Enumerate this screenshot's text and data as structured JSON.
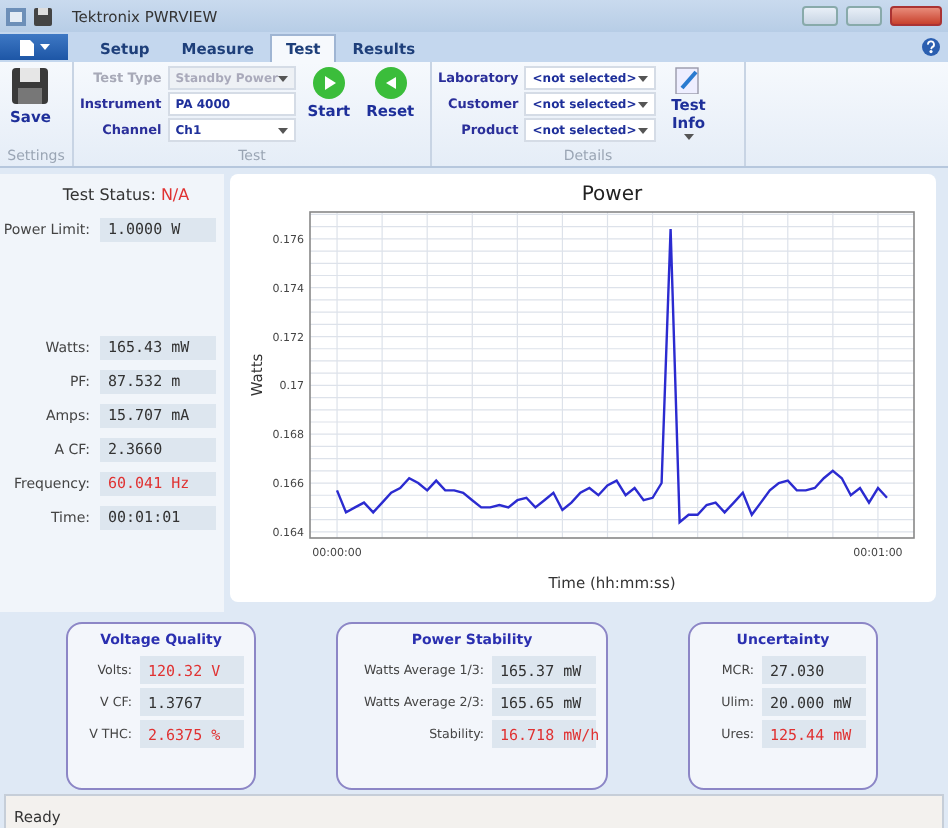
{
  "window": {
    "title": "Tektronix PWRVIEW"
  },
  "tabs": [
    {
      "label": "Setup",
      "selected": false
    },
    {
      "label": "Measure",
      "selected": false
    },
    {
      "label": "Test",
      "selected": true
    },
    {
      "label": "Results",
      "selected": false
    }
  ],
  "settings_group": {
    "label": "Settings",
    "save_button": "Save"
  },
  "test_group": {
    "label": "Test",
    "fields": [
      {
        "label": "Test Type",
        "value": "Standby Power",
        "kind": "dropdown",
        "disabled": true
      },
      {
        "label": "Instrument",
        "value": "PA 4000",
        "kind": "text",
        "disabled": false
      },
      {
        "label": "Channel",
        "value": "Ch1",
        "kind": "dropdown",
        "disabled": false
      }
    ],
    "buttons": [
      {
        "label": "Start",
        "kind": "start"
      },
      {
        "label": "Reset",
        "kind": "reset"
      }
    ]
  },
  "details_group": {
    "label": "Details",
    "fields": [
      {
        "label": "Laboratory",
        "value": "<not selected>"
      },
      {
        "label": "Customer",
        "value": "<not selected>"
      },
      {
        "label": "Product",
        "value": "<not selected>"
      }
    ],
    "test_info_button": "Test Info"
  },
  "test_status": {
    "label": "Test Status:",
    "value": "N/A",
    "alert": true
  },
  "power_limit": {
    "label": "Power Limit:",
    "value": "1.0000 W",
    "alert": false
  },
  "measurements": [
    {
      "label": "Watts:",
      "value": "165.43 mW",
      "alert": false
    },
    {
      "label": "PF:",
      "value": "87.532 m",
      "alert": false
    },
    {
      "label": "Amps:",
      "value": "15.707 mA",
      "alert": false
    },
    {
      "label": "A CF:",
      "value": "2.3660",
      "alert": false
    },
    {
      "label": "Frequency:",
      "value": "60.041 Hz",
      "alert": true
    },
    {
      "label": "Time:",
      "value": "00:01:01",
      "alert": false
    }
  ],
  "chart": {
    "chart_data": {
      "type": "line",
      "title": "Power",
      "xlabel": "Time (hh:mm:ss)",
      "ylabel": "Watts",
      "x": [
        0,
        1,
        2,
        3,
        4,
        5,
        6,
        7,
        8,
        9,
        10,
        11,
        12,
        13,
        14,
        15,
        16,
        17,
        18,
        19,
        20,
        21,
        22,
        23,
        24,
        25,
        26,
        27,
        28,
        29,
        30,
        31,
        32,
        33,
        34,
        35,
        36,
        37,
        38,
        39,
        40,
        41,
        42,
        43,
        44,
        45,
        46,
        47,
        48,
        49,
        50,
        51,
        52,
        53,
        54,
        55,
        56,
        57,
        58,
        59,
        60,
        61
      ],
      "grid": true,
      "series": [
        {
          "color": "#2b2bd0",
          "values": [
            0.1657,
            0.1648,
            0.165,
            0.1652,
            0.1648,
            0.1652,
            0.1656,
            0.1658,
            0.1662,
            0.166,
            0.1657,
            0.1661,
            0.1657,
            0.1657,
            0.1656,
            0.1653,
            0.165,
            0.165,
            0.1651,
            0.165,
            0.1653,
            0.1654,
            0.165,
            0.1653,
            0.1656,
            0.1649,
            0.1652,
            0.1656,
            0.1658,
            0.1655,
            0.1659,
            0.1661,
            0.1655,
            0.1658,
            0.1653,
            0.1654,
            0.166,
            0.1764,
            0.1644,
            0.1647,
            0.1647,
            0.1651,
            0.1652,
            0.1648,
            0.1652,
            0.1656,
            0.1647,
            0.1652,
            0.1657,
            0.166,
            0.1661,
            0.1657,
            0.1657,
            0.1658,
            0.1662,
            0.1665,
            0.1662,
            0.1655,
            0.1658,
            0.1652,
            0.1658,
            0.1654
          ]
        }
      ],
      "xlim": [
        -3,
        64
      ],
      "ylim": [
        0.16375,
        0.1771
      ],
      "xticks": [
        {
          "value": 0,
          "label": "00:00:00"
        },
        {
          "value": 60,
          "label": "00:01:00"
        }
      ],
      "yticks": [
        {
          "value": 0.164,
          "label": "0.164"
        },
        {
          "value": 0.166,
          "label": "0.166"
        },
        {
          "value": 0.168,
          "label": "0.168"
        },
        {
          "value": 0.17,
          "label": "0.17"
        },
        {
          "value": 0.172,
          "label": "0.172"
        },
        {
          "value": 0.174,
          "label": "0.174"
        },
        {
          "value": 0.176,
          "label": "0.176"
        }
      ]
    }
  },
  "panels": [
    {
      "title": "Voltage Quality",
      "rows": [
        {
          "label": "Volts:",
          "value": "120.32 V",
          "alert": true
        },
        {
          "label": "V CF:",
          "value": "1.3767",
          "alert": false
        },
        {
          "label": "V THC:",
          "value": "2.6375 %",
          "alert": true
        }
      ]
    },
    {
      "title": "Power Stability",
      "rows": [
        {
          "label": "Watts Average 1/3:",
          "value": "165.37 mW",
          "alert": false
        },
        {
          "label": "Watts Average 2/3:",
          "value": "165.65 mW",
          "alert": false
        },
        {
          "label": "Stability:",
          "value": "16.718 mW/h",
          "alert": true
        }
      ]
    },
    {
      "title": "Uncertainty",
      "rows": [
        {
          "label": "MCR:",
          "value": "27.030",
          "alert": false
        },
        {
          "label": "Ulim:",
          "value": "20.000 mW",
          "alert": false
        },
        {
          "label": "Ures:",
          "value": "125.44 mW",
          "alert": true
        }
      ]
    }
  ],
  "status_bar": {
    "text": "Ready"
  }
}
